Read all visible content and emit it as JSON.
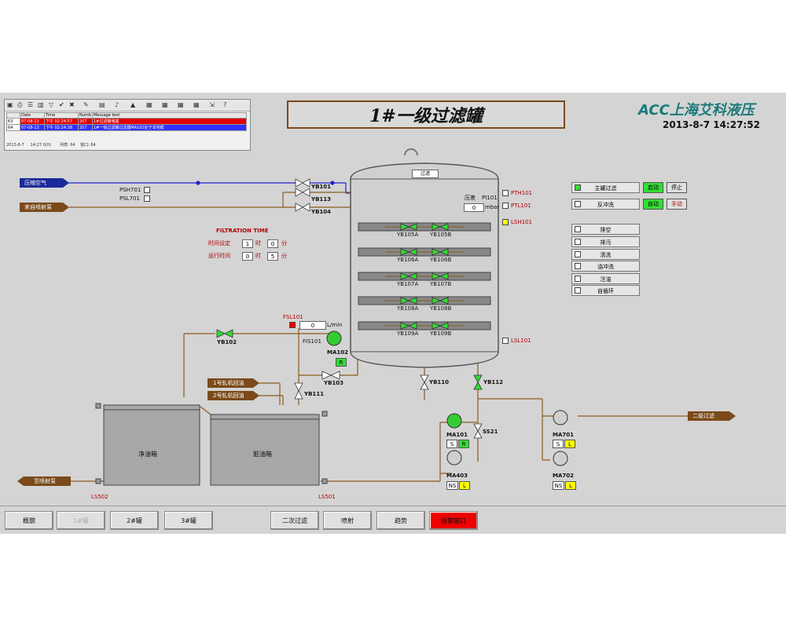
{
  "alarm_panel": {
    "toolbar_icons": [
      "window-icon",
      "print-icon",
      "list-icon",
      "filter-icon",
      "acknowledge-icon",
      "pin-icon",
      "lock-icon",
      "help-icon"
    ],
    "headers": [
      "",
      "Date",
      "Time",
      "Numb",
      "Message text"
    ],
    "rows": [
      {
        "no": "63",
        "date": "07-08-13",
        "time": "下午 02:24:57",
        "numb": "207",
        "text": "1#过滤罐堵塞",
        "color": "#e00000"
      },
      {
        "no": "64",
        "date": "07-08-13",
        "time": "下午 02:24:38",
        "numb": "207",
        "text": "1#一级过滤罐过滤器MA102处于本地模",
        "color": "#2a2aff"
      }
    ],
    "status_left": "2013-8-7",
    "status_mid": "14:27  0(0)",
    "status_list": "列表: 64",
    "status_win": "窗口: 64"
  },
  "header": {
    "title": "1#一级过滤罐",
    "brand": "ACC上海艾科液压",
    "datetime": "2013-8-7  14:27:52"
  },
  "pipes": {
    "compressed_air": "压缩空气",
    "from_sprayer": "来自喷射泵",
    "to_sprayer": "至喷射泵",
    "secondary_filter": "二级过滤",
    "mill1_return": "1号轧机回油",
    "mill2_return": "2号轧机回油"
  },
  "filtration": {
    "title": "FILTRATION  TIME",
    "set_label": "时间设定",
    "run_label": "运行时间",
    "hour_unit": "时",
    "min_unit": "分",
    "set_h": "1",
    "set_m": "0",
    "run_h": "0",
    "run_m": "5"
  },
  "instruments": {
    "psh701": "PSH701",
    "psl701": "PSL701",
    "pth101": "PTH101",
    "ptl101": "PTL101",
    "lsh101": "LSH101",
    "lsl101": "LSL101",
    "pi101": "PI101",
    "pi_label": "压差",
    "pi_value": "0",
    "pi_unit": "mbar",
    "fsl101": "FSL101",
    "fis101": "FIS101",
    "flow_value": "0",
    "flow_unit": "L/min",
    "ls502": "LS502",
    "ls501": "LS501",
    "tank_top": "过滤"
  },
  "valves": {
    "yb101": "YB101",
    "yb113": "YB113",
    "yb104": "YB104",
    "yb102": "YB102",
    "yb103": "YB103",
    "yb111": "YB111",
    "yb110": "YB110",
    "yb112": "YB112",
    "ss21": "SS21",
    "elements": [
      [
        "YB105A",
        "YB105B"
      ],
      [
        "YB106A",
        "YB106B"
      ],
      [
        "YB107A",
        "YB107B"
      ],
      [
        "YB108A",
        "YB108B"
      ],
      [
        "YB109A",
        "YB109B"
      ]
    ]
  },
  "pumps": {
    "ma102": {
      "name": "MA102",
      "s1": "R"
    },
    "ma101": {
      "name": "MA101",
      "s1": "S",
      "s2": "R"
    },
    "ma403": {
      "name": "MA403",
      "s1": "NS",
      "s2": "L"
    },
    "ma701": {
      "name": "MA701",
      "s1": "S",
      "s2": "L"
    },
    "ma702": {
      "name": "MA702",
      "s1": "NS",
      "s2": "L"
    }
  },
  "tanks": {
    "clean": "净油箱",
    "dirty": "脏油箱"
  },
  "controls": {
    "main_filter": "主罐过滤",
    "start": "启动",
    "stop": "停止",
    "backwash": "反冲洗",
    "auto": "自动",
    "manual": "手动",
    "modes": [
      "排空",
      "排污",
      "清洗",
      "油冲洗",
      "注油",
      "自循环"
    ]
  },
  "nav": {
    "overview": "概貌",
    "tank1": "1#罐",
    "tank2": "2#罐",
    "tank3": "3#罐",
    "secondary": "二次过滤",
    "spray": "喷射",
    "trend": "趋势",
    "alarm": "报警窗口"
  },
  "colors": {
    "alarm_red": "#ee0000",
    "run_green": "#33dd33",
    "local_yellow": "#ffff00",
    "pipe_brown": "#8a5a1e",
    "pipe_blue": "#2222cc"
  }
}
